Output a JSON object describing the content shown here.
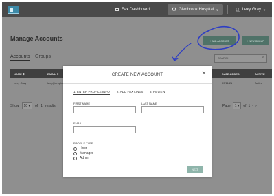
{
  "topbar": {
    "nav_fax": "Fax Dashboard",
    "hospital": "Glenbrook Hospital",
    "user": "Lexy Gray"
  },
  "page": {
    "title": "Manage Accounts",
    "tabs": [
      "Accounts",
      "Groups"
    ],
    "add_account_label": "+ ADD ACCOUNT",
    "new_group_label": "+ NEW GROUP",
    "search_placeholder": "SEARCH"
  },
  "table": {
    "columns": [
      "NAME",
      "EMAIL",
      "DATE ADDED",
      "ACTIVE"
    ],
    "rows": [
      {
        "name": "Lexy Gray",
        "email": "lexy@empiricadb.com",
        "date_added": "03/11/21",
        "active": "Active"
      }
    ]
  },
  "pagination": {
    "show_label": "Show",
    "per_page": "10",
    "of_label": "of",
    "total_pages": "1",
    "results_label": "results",
    "page_label": "Page",
    "current_page": "1"
  },
  "modal": {
    "title": "CREATE NEW ACCOUNT",
    "steps": [
      "1. ENTER PROFILE INFO",
      "2. ADD FAX LINES",
      "3. REVIEW"
    ],
    "first_name_label": "FIRST NAME",
    "last_name_label": "LAST NAME",
    "email_label": "EMAIL",
    "profile_type_label": "PROFILE TYPE",
    "profile_types": [
      "User",
      "Manager",
      "Admin"
    ],
    "next_label": "NEXT"
  },
  "colors": {
    "overlay": "#8f8f8f",
    "topbar": "#4a4a4a",
    "accent_button": "#4f7268",
    "next_button": "#8fb5ab",
    "annotation": "#2d3dc4"
  },
  "icons": {
    "gear": "gear-icon",
    "user": "user-icon",
    "fax": "fax-icon",
    "search": "search-icon",
    "close": "close-icon"
  }
}
